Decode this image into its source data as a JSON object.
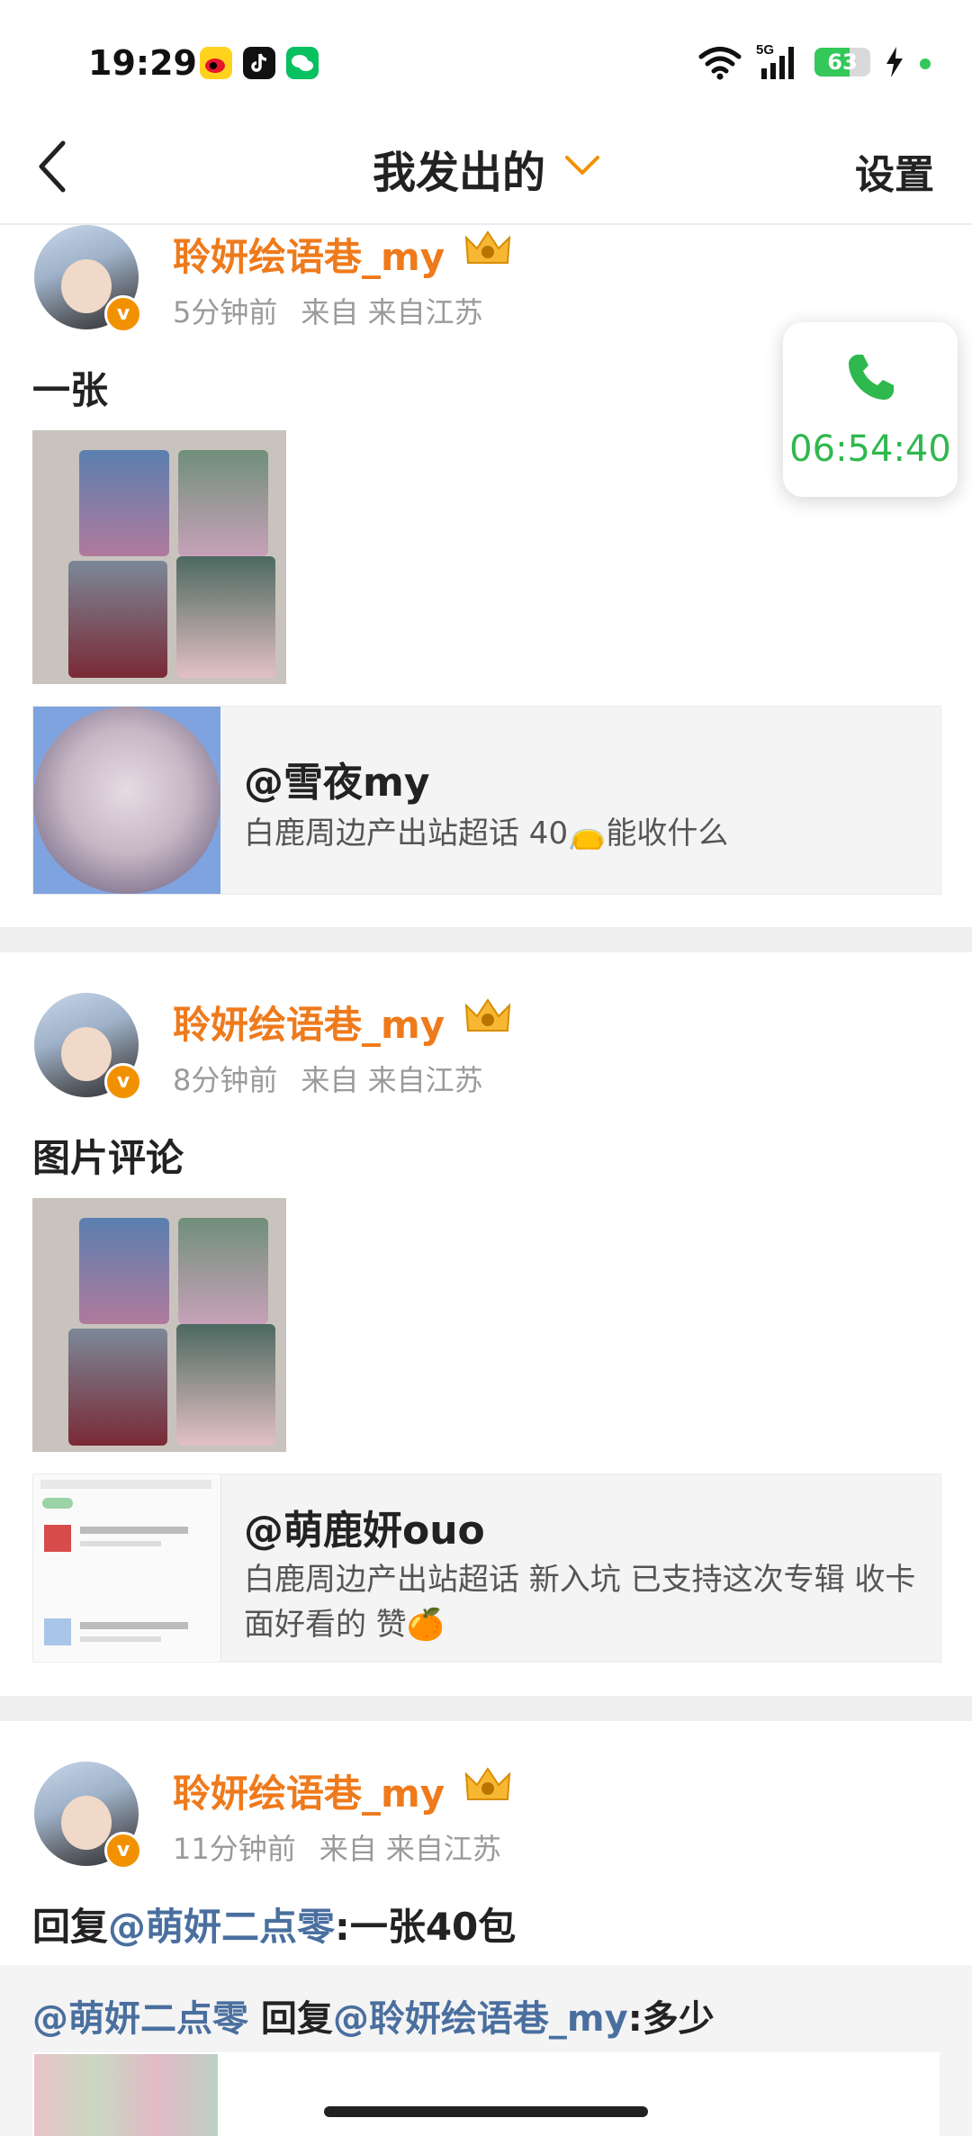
{
  "status": {
    "time": "19:29",
    "network": "5G",
    "battery": "63",
    "battery_level": 0.63
  },
  "header": {
    "title": "我发出的",
    "settings": "设置"
  },
  "call": {
    "timer": "06:54:40"
  },
  "posts": [
    {
      "username": "聆妍绘语巷_my",
      "time_ago": "5分钟前",
      "source_label": "来自",
      "source": "来自江苏",
      "text": "一张",
      "quote": {
        "name": "@雪夜my",
        "text": "白鹿周边产出站超话 40👝能收什么"
      }
    },
    {
      "username": "聆妍绘语巷_my",
      "time_ago": "8分钟前",
      "source_label": "来自",
      "source": "来自江苏",
      "text": "图片评论",
      "quote": {
        "name": "@萌鹿妍ouo",
        "text": "白鹿周边产出站超话 新入坑 已支持这次专辑 收卡面好看的 赞🍊"
      }
    },
    {
      "username": "聆妍绘语巷_my",
      "time_ago": "11分钟前",
      "source_label": "来自",
      "source": "来自江苏",
      "text_prefix": "回复",
      "text_mention": "@萌妍二点零",
      "text_suffix": ":一张40包",
      "reply": {
        "mention1": "@萌妍二点零",
        "middle": " 回复",
        "mention2": "@聆妍绘语巷_my",
        "suffix": ":多少"
      }
    }
  ],
  "colors": {
    "accent": "#ef7a1b",
    "mention": "#4a6f9f",
    "call": "#2fb84e"
  }
}
